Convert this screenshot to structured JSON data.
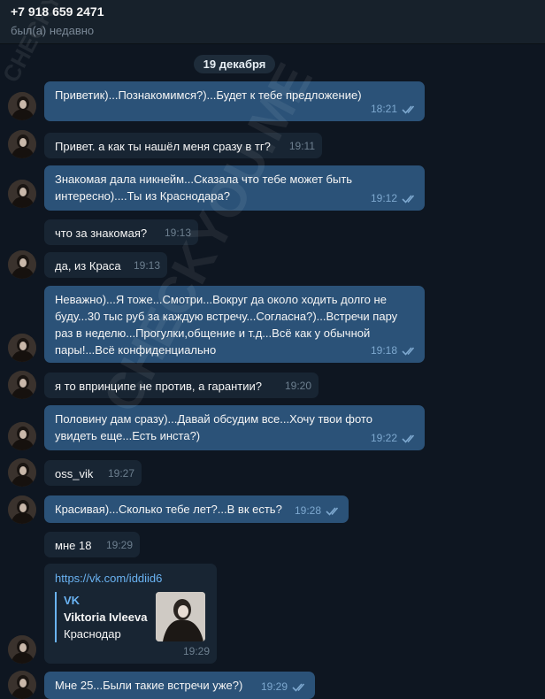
{
  "header": {
    "phone": "+7 918 659 2471",
    "status": "был(а) недавно"
  },
  "date_label": "19 декабря",
  "watermark_text": "CHECKYOU.ME",
  "messages": [
    {
      "text": "Приветик)...Познакомимся?)...Будет к тебе предложение)",
      "time": "18:21",
      "direction": "out"
    },
    {
      "text": "Привет. а как ты нашёл меня сразу в тг?",
      "time": "19:11",
      "direction": "in"
    },
    {
      "text": "Знакомая дала никнейм...Сказала что тебе может быть интересно)....Ты из Краснодара?",
      "time": "19:12",
      "direction": "out"
    },
    {
      "text": "что за знакомая?",
      "time": "19:13",
      "direction": "in"
    },
    {
      "text": "да, из Краса",
      "time": "19:13",
      "direction": "in"
    },
    {
      "text": "Неважно)...Я тоже...Смотри...Вокруг да около ходить долго не буду...30 тыс руб за каждую встречу...Согласна?)...Встречи пару раз в неделю...Прогулки,общение и т.д...Всё как у обычной пары!...Всё конфиденциально",
      "time": "19:18",
      "direction": "out"
    },
    {
      "text": "я то впринципе не против, а гарантии?",
      "time": "19:20",
      "direction": "in"
    },
    {
      "text": "Половину дам сразу)...Давай обсудим все...Хочу твои фото увидеть еще...Есть инста?)",
      "time": "19:22",
      "direction": "out"
    },
    {
      "text": "oss_vik",
      "time": "19:27",
      "direction": "in"
    },
    {
      "text": "Красивая)...Сколько тебе лет?...В вк есть?",
      "time": "19:28",
      "direction": "out"
    },
    {
      "text": "мне 18",
      "time": "19:29",
      "direction": "in"
    },
    {
      "link": "https://vk.com/iddiid6",
      "preview_source": "VK",
      "preview_name": "Viktoria Ivleeva",
      "preview_city": "Краснодар",
      "time": "19:29",
      "direction": "in"
    },
    {
      "text": "Мне 25...Были такие встречи уже?)",
      "time": "19:29",
      "direction": "out"
    }
  ],
  "colors": {
    "background": "#0e1621",
    "header": "#17212b",
    "outgoing_bubble": "#2b5278",
    "incoming_bubble": "#182533",
    "link": "#6ab3f3"
  }
}
